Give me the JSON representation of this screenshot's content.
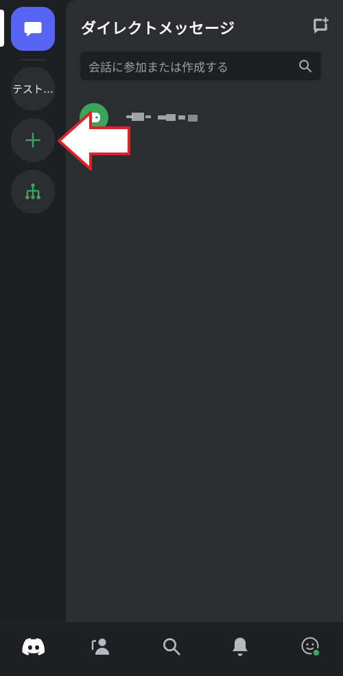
{
  "header": {
    "title": "ダイレクトメッセージ"
  },
  "search": {
    "placeholder": "会話に参加または作成する"
  },
  "servers": [
    {
      "label": "テスト…"
    }
  ],
  "dm_list": [
    {
      "name": "[redacted]"
    }
  ],
  "colors": {
    "accent": "#5865f2",
    "green": "#3ba55c",
    "annotation_arrow": "#d8232a"
  },
  "icons": {
    "home": "discord-logo-icon",
    "friends": "friends-icon",
    "search": "search-icon",
    "notifications": "bell-icon",
    "profile": "profile-icon"
  }
}
